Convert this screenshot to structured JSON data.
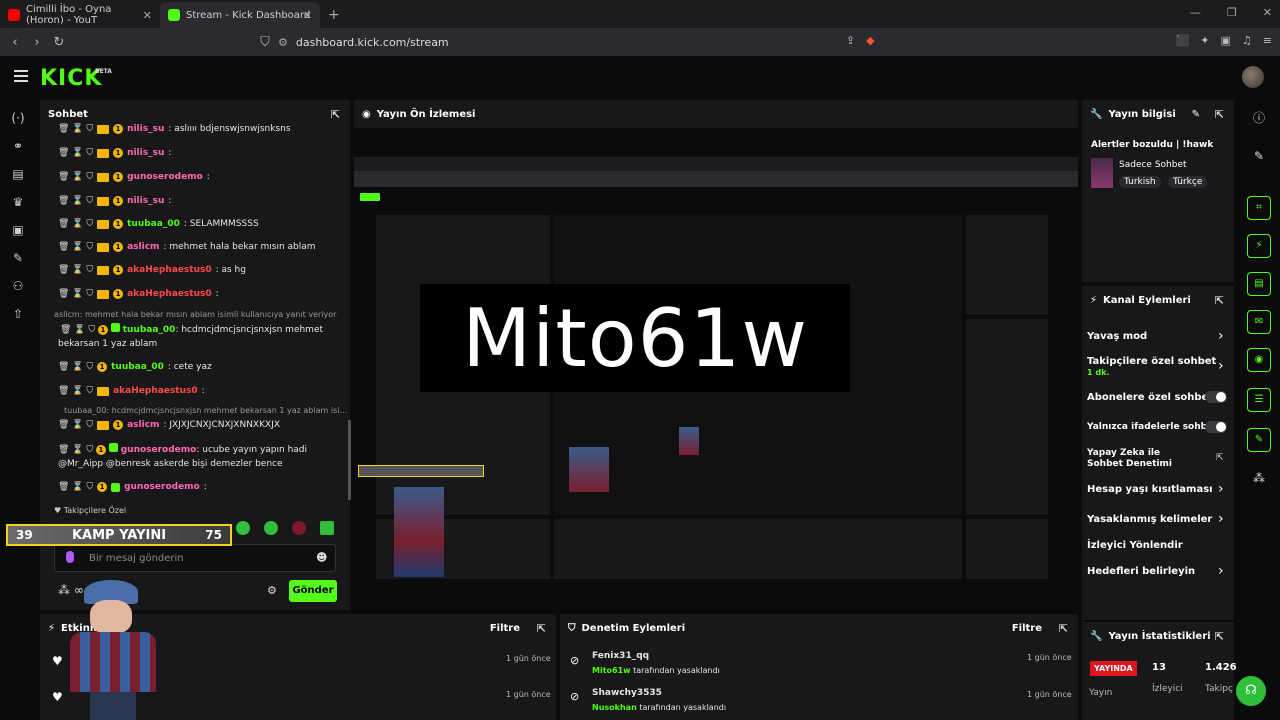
{
  "browser": {
    "tabs": [
      {
        "label": "Cimilli İbo - Oyna (Horon) - YouT",
        "color": "#ff0000"
      },
      {
        "label": "Stream - Kick Dashboard",
        "color": "#53fc18"
      }
    ],
    "url": "dashboard.kick.com/stream"
  },
  "brand": {
    "logo": "KICK",
    "beta": "BETA",
    "accent": "#53fc18"
  },
  "chat": {
    "title": "Sohbet",
    "lines": [
      {
        "user": "nilis_su",
        "msg": ": aslıııı bdjenswjsnwjsnksns",
        "color": "#ff69b4"
      },
      {
        "user": "nilis_su",
        "msg": ":",
        "color": "#ff69b4"
      },
      {
        "user": "gunoserodemo",
        "msg": ":",
        "color": "#ff69b4"
      },
      {
        "user": "nilis_su",
        "msg": ":",
        "color": "#ff69b4"
      },
      {
        "user": "tuubaa_00",
        "msg": ": SELAMMMSSSS",
        "color": "#53fc18"
      },
      {
        "user": "aslicm",
        "msg": ": mehmet hala bekar mısın ablam",
        "color": "#ff69b4"
      },
      {
        "user": "akaHephaestus0",
        "msg": ": as hg",
        "color": "#ff4a4a"
      },
      {
        "user": "akaHephaestus0",
        "msg": ":",
        "color": "#ff4a4a"
      }
    ],
    "reply1": "aslicm: mehmet hala bekar mısın ablam isimli kullanıcıya yanıt veriyor",
    "reply1_user": "tuubaa_00",
    "reply1_msg": ": hcdmcjdmcjsncjsnxjsn mehmet bekarsan 1 yaz ablam",
    "line_cete_user": "tuubaa_00",
    "line_cete_msg": ": cete yaz",
    "line_aka_user": "akaHephaestus0",
    "reply2": "tuubaa_00: hcdmcjdmcjsncjsnxjsn mehmet bekarsan 1 yaz ablam isi...",
    "line_x_user": "aslicm",
    "line_x_msg": ": JXJXJCNXJCNXJXNNXKXJX",
    "line_g_user": "gunoserodemo",
    "line_g_msg": ": ucube yayın yapın hadi @Mr_Aipp @benresk askerde bişi demezler bence",
    "line_last_user": "gunoserodemo",
    "line_last_msg": ":",
    "followers_only": "Takipçilere Özel",
    "input_placeholder": "Bir mesaj gönderin",
    "send": "Gönder"
  },
  "overlay": {
    "left": "39",
    "label": "KAMP YAYINI",
    "right": "75"
  },
  "preview": {
    "title": "Yayın Ön İzlemesi",
    "overlay_text": "Mito61w"
  },
  "stream_info": {
    "title": "Yayın bilgisi",
    "stream_title": "Alertler bozuldu | !hawk",
    "category": "Sadece Sohbet",
    "tags": [
      "Turkish",
      "Türkçe"
    ]
  },
  "channel_actions": {
    "title": "Kanal Eylemleri",
    "slow_mode": "Yavaş mod",
    "followers_chat": "Takipçilere özel sohbet",
    "followers_sub": "1 dk.",
    "subscribers_chat": "Abonelere özel sohbet",
    "emotes_only": "Yalnızca ifadelerle sohbet",
    "ai_moderation": "Yapay Zeka ile Sohbet Denetimi",
    "account_age": "Hesap yaşı kısıtlaması",
    "banned_words": "Yasaklanmış kelimeler",
    "viewer_redirect": "İzleyici Yönlendir",
    "set_targets": "Hedefleri belirleyin"
  },
  "activity": {
    "title": "Etkinlikler",
    "filter": "Filtre",
    "rows": [
      {
        "time": "1 gün önce"
      },
      {
        "time": "1 gün önce"
      }
    ]
  },
  "moderation": {
    "title": "Denetim Eylemleri",
    "filter": "Filtre",
    "rows": [
      {
        "user": "Fenix31_qq",
        "by": "Mito61w",
        "action": "tarafından yasaklandı",
        "time": "1 gün önce"
      },
      {
        "user": "Shawchy3535",
        "by": "Nusokhan",
        "action": "tarafından yasaklandı",
        "time": "1 gün önce"
      }
    ]
  },
  "stats": {
    "title": "Yayın İstatistikleri",
    "live": "YAYINDA",
    "viewers": "13",
    "followers": "1.426",
    "label_stream": "Yayın",
    "label_viewers": "İzleyici",
    "label_followers": "Takipçi"
  }
}
